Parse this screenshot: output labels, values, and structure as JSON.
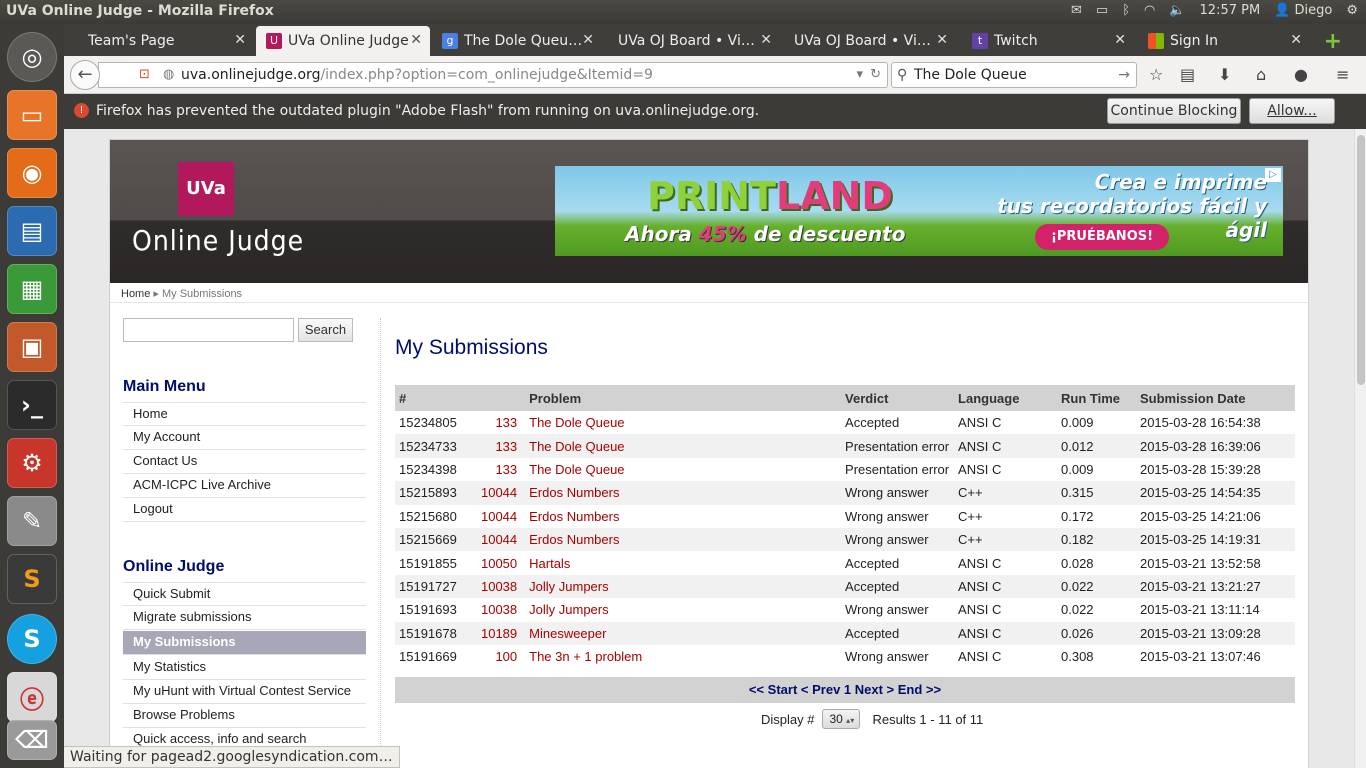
{
  "system": {
    "window_title": "UVa Online Judge - Mozilla Firefox",
    "clock": "12:57 PM",
    "user": "Diego"
  },
  "tabs": [
    {
      "label": "Team's Page",
      "icon": "none"
    },
    {
      "label": "UVa Online Judge",
      "icon": "uva"
    },
    {
      "label": "The Dole Queu…",
      "icon": "google"
    },
    {
      "label": "UVa OJ Board • Vi…",
      "icon": "none"
    },
    {
      "label": "UVa OJ Board • Vi…",
      "icon": "none"
    },
    {
      "label": "Twitch",
      "icon": "twitch"
    },
    {
      "label": "Sign In",
      "icon": "microsoft"
    }
  ],
  "navbar": {
    "url_host": "uva.onlinejudge.org",
    "url_path": "/index.php?option=com_onlinejudge&Itemid=9",
    "search_value": "The Dole Queue"
  },
  "notification": {
    "message": "Firefox has prevented the outdated plugin \"Adobe Flash\" from running on uva.onlinejudge.org.",
    "continue_label": "Continue Blocking",
    "allow_label": "Allow..."
  },
  "site": {
    "logo": "UVa",
    "title": "Online Judge",
    "ad": {
      "brand_a": "PRINT",
      "brand_b": "LAND",
      "promo_a": "Ahora",
      "promo_pct": "45%",
      "promo_b": "de descuento",
      "tagline_1": "Crea e imprime",
      "tagline_2": "tus recordatorios fácil y ágil",
      "cta": "¡PRUÉBANOS!"
    }
  },
  "breadcrumb": {
    "home": "Home",
    "current": "My Submissions"
  },
  "sidebar": {
    "search_button": "Search",
    "main_menu_title": "Main Menu",
    "main_menu": [
      "Home",
      "My Account",
      "Contact Us",
      "ACM-ICPC Live Archive",
      "Logout"
    ],
    "oj_title": "Online Judge",
    "oj_menu": [
      "Quick Submit",
      "Migrate submissions",
      "My Submissions",
      "My Statistics",
      "My uHunt with Virtual Contest Service",
      "Browse Problems",
      "Quick access, info and search"
    ]
  },
  "main": {
    "heading": "My Submissions",
    "columns": [
      "#",
      "Problem",
      "Verdict",
      "Language",
      "Run Time",
      "Submission Date"
    ],
    "rows": [
      {
        "id": "15234805",
        "pnum": "133",
        "ptitle": "The Dole Queue",
        "verdict": "Accepted",
        "lang": "ANSI C",
        "time": "0.009",
        "date": "2015-03-28 16:54:38"
      },
      {
        "id": "15234733",
        "pnum": "133",
        "ptitle": "The Dole Queue",
        "verdict": "Presentation error",
        "lang": "ANSI C",
        "time": "0.012",
        "date": "2015-03-28 16:39:06"
      },
      {
        "id": "15234398",
        "pnum": "133",
        "ptitle": "The Dole Queue",
        "verdict": "Presentation error",
        "lang": "ANSI C",
        "time": "0.009",
        "date": "2015-03-28 15:39:28"
      },
      {
        "id": "15215893",
        "pnum": "10044",
        "ptitle": "Erdos Numbers",
        "verdict": "Wrong answer",
        "lang": "C++",
        "time": "0.315",
        "date": "2015-03-25 14:54:35"
      },
      {
        "id": "15215680",
        "pnum": "10044",
        "ptitle": "Erdos Numbers",
        "verdict": "Wrong answer",
        "lang": "C++",
        "time": "0.172",
        "date": "2015-03-25 14:21:06"
      },
      {
        "id": "15215669",
        "pnum": "10044",
        "ptitle": "Erdos Numbers",
        "verdict": "Wrong answer",
        "lang": "C++",
        "time": "0.182",
        "date": "2015-03-25 14:19:31"
      },
      {
        "id": "15191855",
        "pnum": "10050",
        "ptitle": "Hartals",
        "verdict": "Accepted",
        "lang": "ANSI C",
        "time": "0.028",
        "date": "2015-03-21 13:52:58"
      },
      {
        "id": "15191727",
        "pnum": "10038",
        "ptitle": "Jolly Jumpers",
        "verdict": "Accepted",
        "lang": "ANSI C",
        "time": "0.022",
        "date": "2015-03-21 13:21:27"
      },
      {
        "id": "15191693",
        "pnum": "10038",
        "ptitle": "Jolly Jumpers",
        "verdict": "Wrong answer",
        "lang": "ANSI C",
        "time": "0.022",
        "date": "2015-03-21 13:11:14"
      },
      {
        "id": "15191678",
        "pnum": "10189",
        "ptitle": "Minesweeper",
        "verdict": "Accepted",
        "lang": "ANSI C",
        "time": "0.026",
        "date": "2015-03-21 13:09:28"
      },
      {
        "id": "15191669",
        "pnum": "100",
        "ptitle": "The 3n + 1 problem",
        "verdict": "Wrong answer",
        "lang": "ANSI C",
        "time": "0.308",
        "date": "2015-03-21 13:07:46"
      }
    ],
    "pager": "<< Start < Prev 1 Next > End >>",
    "display_label": "Display #",
    "display_value": "30",
    "results": "Results 1 - 11 of 11"
  },
  "status_text": "Waiting for pagead2.googlesyndication.com…",
  "colors": {
    "accent": "#000e6b",
    "problem_link": "#aa0000",
    "uva_brand": "#b2185c"
  }
}
